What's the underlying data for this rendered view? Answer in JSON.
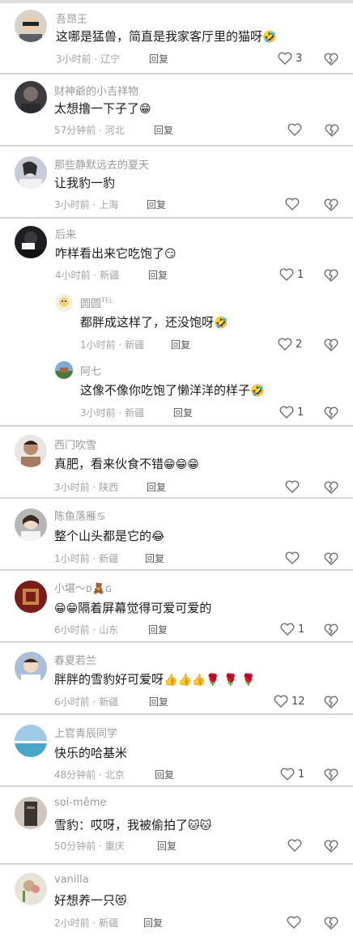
{
  "comments": [
    {
      "name": "吾昂王",
      "text": "这哪是猛兽，简直是我家客厅里的猫呀",
      "emoji": "🤣",
      "meta": "3小时前 · 辽宁",
      "reply": "回复",
      "likes": "3"
    },
    {
      "name": "财神爺的小吉祥物",
      "text": "太想撸一下子了",
      "emoji": "😁",
      "meta": "57分钟前 · 河北",
      "reply": "回复",
      "likes": ""
    },
    {
      "name": "那些静默远去的夏天",
      "text": "让我豹一豹",
      "emoji": "",
      "meta": "3小时前 · 上海",
      "reply": "回复",
      "likes": ""
    },
    {
      "name": "后来",
      "text": "咋样看出来它吃饱了",
      "emoji": "😏",
      "meta": "4小时前 · 新疆",
      "reply": "回复",
      "likes": "1",
      "replies": [
        {
          "name": "圆圆",
          "name_suffix": "TEL",
          "text": "都胖成这样了，还没饱呀",
          "emoji": "🤣",
          "meta": "1小时前 · 新疆",
          "reply": "回复",
          "likes": "2"
        },
        {
          "name": "阿七",
          "name_suffix": "",
          "text": "这像不像你吃饱了懒洋洋的样子",
          "emoji": "🤣",
          "meta": "3小时前 · 新疆",
          "reply": "回复",
          "likes": "1"
        }
      ]
    },
    {
      "name": "西门吹雪",
      "text": "真肥，看来伙食不错",
      "emoji": "😁😁😁",
      "meta": "3小时前 · 陕西",
      "reply": "回复",
      "likes": ""
    },
    {
      "name": "陈鱼落雁♋",
      "text": "整个山头都是它的",
      "emoji": "😂",
      "meta": "1小时前 · 新疆",
      "reply": "回复",
      "likes": ""
    },
    {
      "name": "小堪～ᴅ🧸ɢ",
      "text": "隔着屏幕觉得可爱可爱的",
      "emoji_prefix": "😁😁",
      "emoji": "",
      "meta": "6小时前 · 山东",
      "reply": "回复",
      "likes": "1"
    },
    {
      "name": "春夏若兰",
      "text": "胖胖的雪豹好可爱呀",
      "emoji": "👍👍👍🌹 🌹 🌹",
      "meta": "6小时前 · 新疆",
      "reply": "回复",
      "likes": "12"
    },
    {
      "name": "上官青辰同学",
      "text": "快乐的哈基米",
      "emoji": "",
      "meta": "48分钟前 · 北京",
      "reply": "回复",
      "likes": "1"
    },
    {
      "name": "soi-même",
      "text": "雪豹：哎呀，我被偷拍了",
      "emoji": "🐱🐱",
      "meta": "50分钟前 · 重庆",
      "reply": "回复",
      "likes": ""
    },
    {
      "name": "vanilla",
      "text": "好想养一只",
      "emoji": "😻",
      "meta": "2小时前 · 新疆",
      "reply": "回复",
      "likes": ""
    }
  ],
  "icons": {
    "like": "heart-outline-icon",
    "dislike": "broken-heart-icon"
  },
  "colors": {
    "name": "#9a9a9a",
    "text": "#1a1a1a",
    "meta": "#a3a3a3",
    "divider": "#d4d4d4"
  }
}
